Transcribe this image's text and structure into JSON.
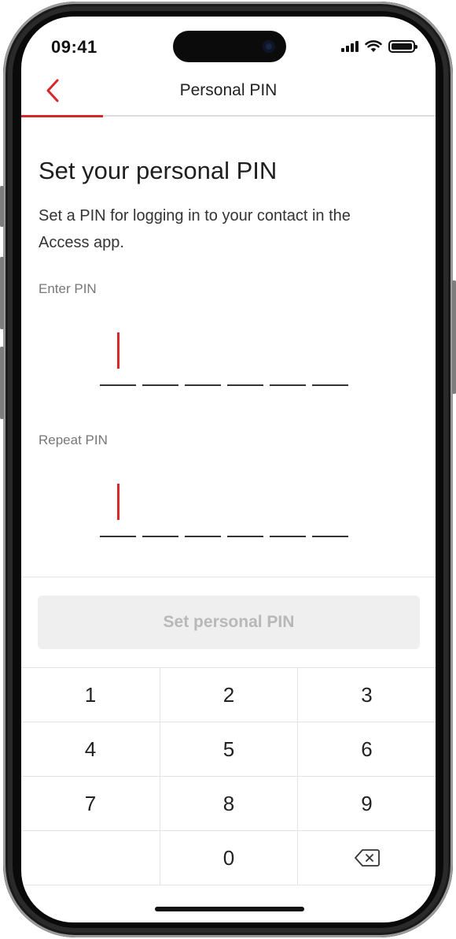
{
  "status_bar": {
    "time": "09:41"
  },
  "header": {
    "title": "Personal PIN"
  },
  "content": {
    "heading": "Set your personal PIN",
    "description": "Set a PIN for logging in to your contact in the Access app.",
    "enter_pin_label": "Enter PIN",
    "repeat_pin_label": "Repeat PIN",
    "pin_length": 6
  },
  "action": {
    "set_pin_label": "Set personal PIN",
    "enabled": false
  },
  "keypad": {
    "keys": [
      "1",
      "2",
      "3",
      "4",
      "5",
      "6",
      "7",
      "8",
      "9",
      "",
      "0",
      "backspace-icon"
    ]
  },
  "colors": {
    "accent": "#d62828",
    "disabled_button_bg": "#efefef",
    "disabled_button_text": "#b8b8b8"
  }
}
